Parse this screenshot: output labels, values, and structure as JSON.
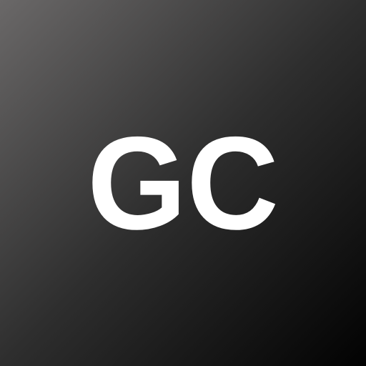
{
  "app_icon": {
    "logo_text": "GC",
    "colors": {
      "background_top": "#6a6868",
      "background_mid": "#2e2e2e",
      "background_bottom": "#020202",
      "logo": "#ffffff"
    }
  }
}
